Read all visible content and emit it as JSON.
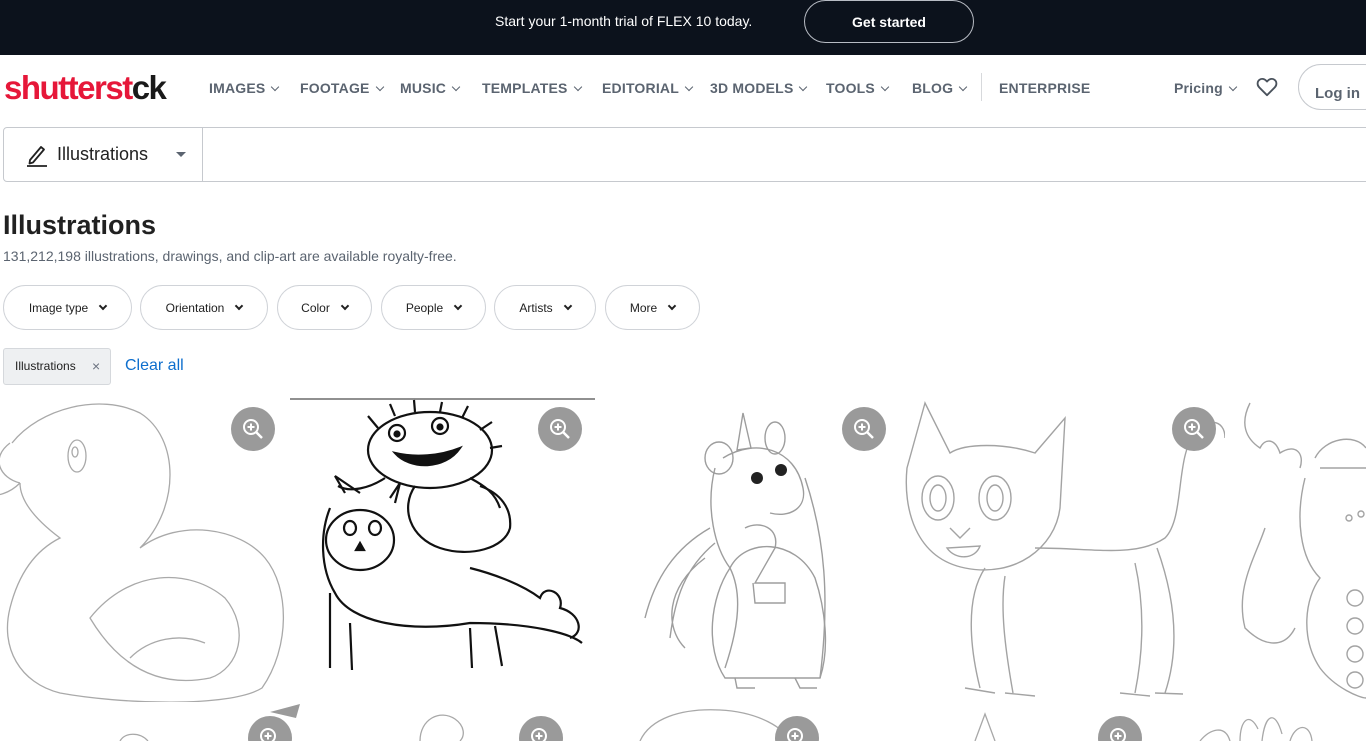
{
  "promo": {
    "text": "Start your 1-month trial of FLEX 10 today.",
    "button": "Get started"
  },
  "nav": {
    "logo": {
      "main": "shutterst",
      "accent": "ck"
    },
    "items": [
      {
        "label": "IMAGES"
      },
      {
        "label": "FOOTAGE"
      },
      {
        "label": "MUSIC"
      },
      {
        "label": "TEMPLATES"
      },
      {
        "label": "EDITORIAL"
      },
      {
        "label": "3D MODELS"
      },
      {
        "label": "TOOLS"
      },
      {
        "label": "BLOG"
      }
    ],
    "enterprise": "ENTERPRISE",
    "pricing": "Pricing",
    "login": "Log in"
  },
  "search": {
    "type_label": "Illustrations",
    "placeholder": ""
  },
  "page": {
    "title": "Illustrations",
    "subtitle": "131,212,198 illustrations, drawings, and clip-art are available royalty-free."
  },
  "filters": [
    {
      "label": "Image type"
    },
    {
      "label": "Orientation"
    },
    {
      "label": "Color"
    },
    {
      "label": "People"
    },
    {
      "label": "Artists"
    },
    {
      "label": "More"
    }
  ],
  "active_filter": {
    "label": "Illustrations",
    "remove": "×"
  },
  "clear_all": "Clear all",
  "results": [
    {
      "subject": "rubber duck outline",
      "icon": "zoom-in-icon"
    },
    {
      "subject": "monster riding cat drawing",
      "icon": "zoom-in-icon"
    },
    {
      "subject": "unicorn with number 2 outline",
      "icon": "zoom-in-icon"
    },
    {
      "subject": "kitten outline",
      "icon": "zoom-in-icon"
    },
    {
      "subject": "reindeer snowman outline",
      "icon": "zoom-in-icon"
    }
  ],
  "colors": {
    "brand": "#e61739",
    "promo_bg": "#0c121c",
    "link": "#0d6ecd"
  }
}
